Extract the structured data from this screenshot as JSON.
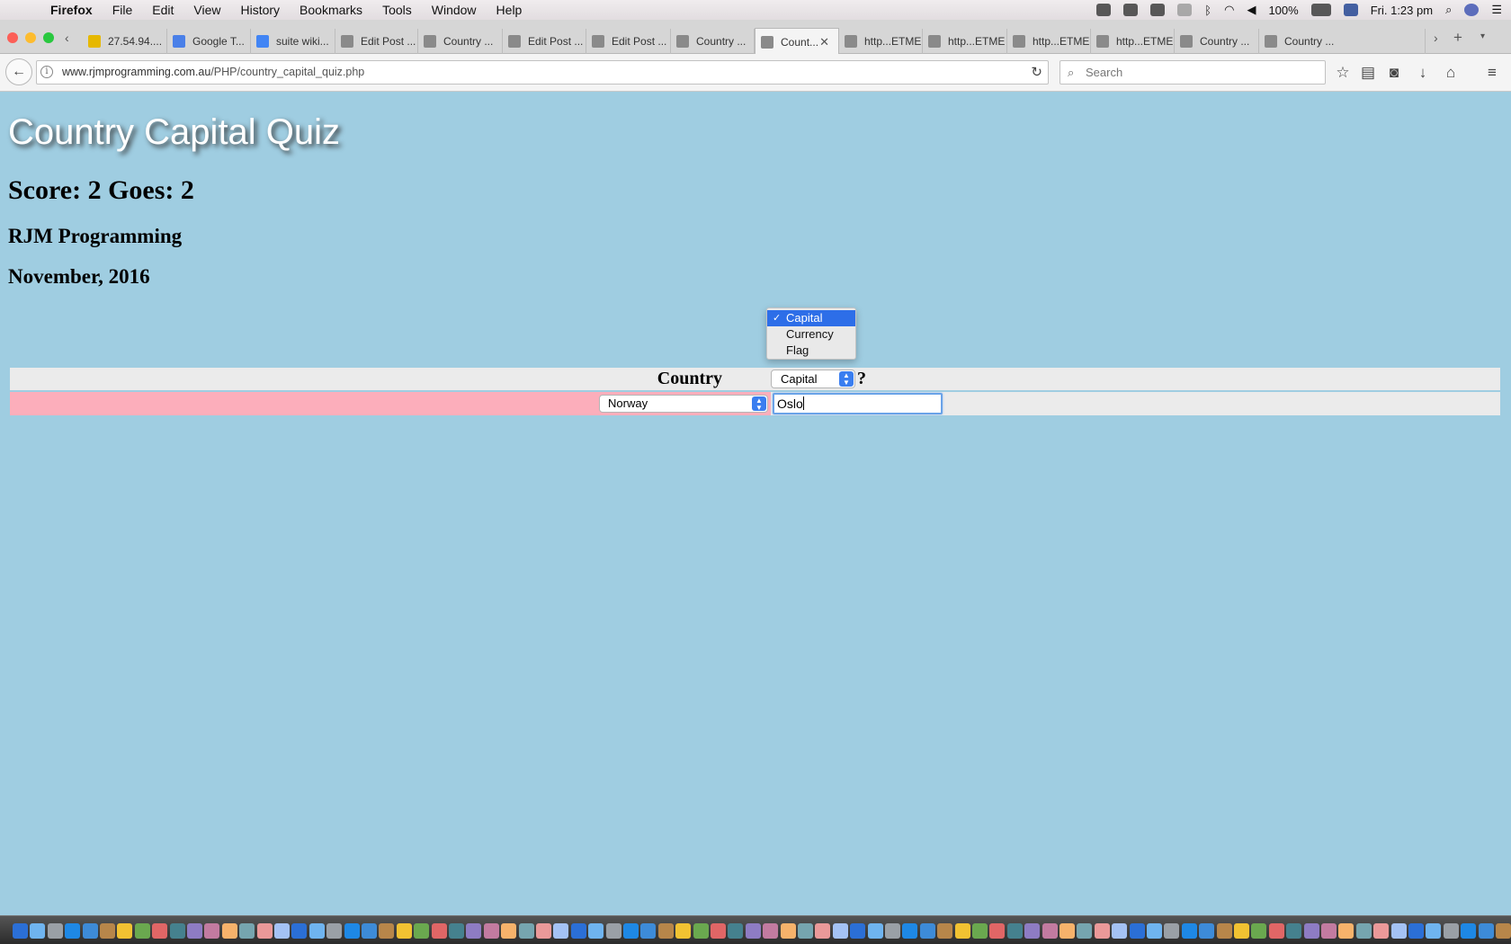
{
  "menubar": {
    "app": "Firefox",
    "items": [
      "File",
      "Edit",
      "View",
      "History",
      "Bookmarks",
      "Tools",
      "Window",
      "Help"
    ],
    "battery": "100%",
    "clock": "Fri. 1:23 pm"
  },
  "tabs": [
    {
      "label": "27.54.94....",
      "icon": "tab-favicon",
      "color": "#e6b800"
    },
    {
      "label": "Google T...",
      "icon": "google-translate-icon",
      "color": "#4a80e8"
    },
    {
      "label": "suite wiki...",
      "icon": "google-icon",
      "color": "#4285f4"
    },
    {
      "label": "Edit Post ...",
      "icon": "site-icon",
      "color": "#8a8a8a"
    },
    {
      "label": "Country ...",
      "icon": "site-icon",
      "color": "#8a8a8a"
    },
    {
      "label": "Edit Post ...",
      "icon": "site-icon",
      "color": "#8a8a8a"
    },
    {
      "label": "Edit Post ...",
      "icon": "site-icon",
      "color": "#8a8a8a"
    },
    {
      "label": "Country ...",
      "icon": "site-icon",
      "color": "#8a8a8a"
    },
    {
      "label": "Count...",
      "icon": "site-icon",
      "color": "#8a8a8a",
      "active": true
    },
    {
      "label": "http...ETME",
      "icon": "site-icon",
      "color": "#8a8a8a"
    },
    {
      "label": "http...ETME",
      "icon": "site-icon",
      "color": "#8a8a8a"
    },
    {
      "label": "http...ETME",
      "icon": "site-icon",
      "color": "#8a8a8a"
    },
    {
      "label": "http...ETME",
      "icon": "site-icon",
      "color": "#8a8a8a"
    },
    {
      "label": "Country ...",
      "icon": "site-icon",
      "color": "#8a8a8a"
    },
    {
      "label": "Country ...",
      "icon": "site-icon",
      "color": "#8a8a8a"
    }
  ],
  "navbar": {
    "url_host": "www.rjmprogramming.com.au",
    "url_path": "/PHP/country_capital_quiz.php",
    "search_placeholder": "Search"
  },
  "page": {
    "title": "Country Capital Quiz",
    "score_line": "Score: 2 Goes: 2",
    "author": "RJM Programming",
    "date": "November, 2016",
    "header_label": "Country",
    "question_mark": "?",
    "type_select_value": "Capital",
    "type_options": [
      {
        "label": "Capital",
        "selected": true
      },
      {
        "label": "Currency",
        "selected": false
      },
      {
        "label": "Flag",
        "selected": false
      }
    ],
    "country_select_value": "Norway",
    "answer_value": "Oslo"
  },
  "colors": {
    "page_background": "#9fcde1",
    "wrong_row": "#fcaebb",
    "selected_option": "#2d6ee8"
  }
}
